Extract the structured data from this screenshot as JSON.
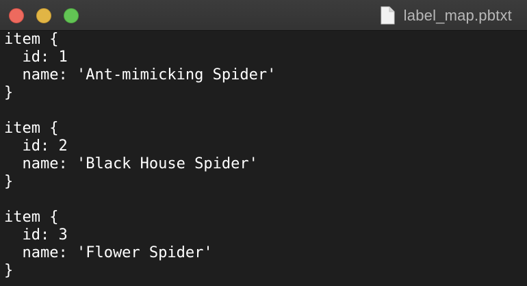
{
  "window": {
    "title": "label_map.pbtxt"
  },
  "icons": {
    "close": "close-window-icon",
    "minimize": "minimize-window-icon",
    "zoom": "zoom-window-icon",
    "document": "document-icon"
  },
  "colors": {
    "close": "#ed6a5e",
    "minimize": "#e1b545",
    "zoom": "#62c454",
    "background": "#1e1e1e",
    "text": "#ffffff"
  },
  "editor": {
    "lines": [
      "item {",
      "  id: 1",
      "  name: 'Ant-mimicking Spider'",
      "}",
      "",
      "item {",
      "  id: 2",
      "  name: 'Black House Spider'",
      "}",
      "",
      "item {",
      "  id: 3",
      "  name: 'Flower Spider'",
      "}"
    ]
  }
}
